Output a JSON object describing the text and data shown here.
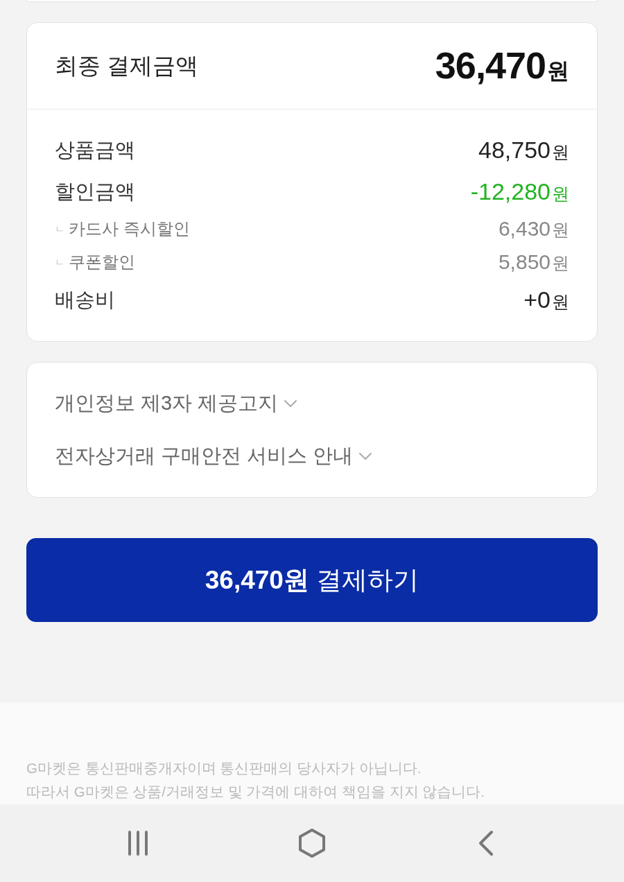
{
  "summary": {
    "title": "최종 결제금액",
    "total": {
      "amount": "36,470",
      "unit": "원"
    },
    "rows": [
      {
        "kind": "main",
        "label": "상품금액",
        "amount": "48,750",
        "unit": "원"
      },
      {
        "kind": "discount",
        "label": "할인금액",
        "amount": "-12,280",
        "unit": "원"
      },
      {
        "kind": "sub",
        "prefix": "ㄴ",
        "label": "카드사 즉시할인",
        "amount": "6,430",
        "unit": "원"
      },
      {
        "kind": "sub",
        "prefix": "ㄴ",
        "label": "쿠폰할인",
        "amount": "5,850",
        "unit": "원"
      },
      {
        "kind": "main",
        "label": "배송비",
        "amount": "+0",
        "unit": "원"
      }
    ]
  },
  "notices": [
    {
      "label": "개인정보 제3자 제공고지",
      "expanded": false
    },
    {
      "label": "전자상거래 구매안전 서비스 안내",
      "expanded": false
    }
  ],
  "pay_button": {
    "label": "**36,470원** 결제하기"
  },
  "footer": {
    "lines": [
      "G마켓은 통신판매중개자이며 통신판매의 당사자가 아닙니다.",
      "따라서 G마켓은 상품/거래정보 및 가격에 대하여 책임을 지지 않습니다."
    ]
  },
  "nav_bar": [
    {
      "kind": "recents"
    },
    {
      "kind": "home"
    },
    {
      "kind": "back"
    }
  ]
}
